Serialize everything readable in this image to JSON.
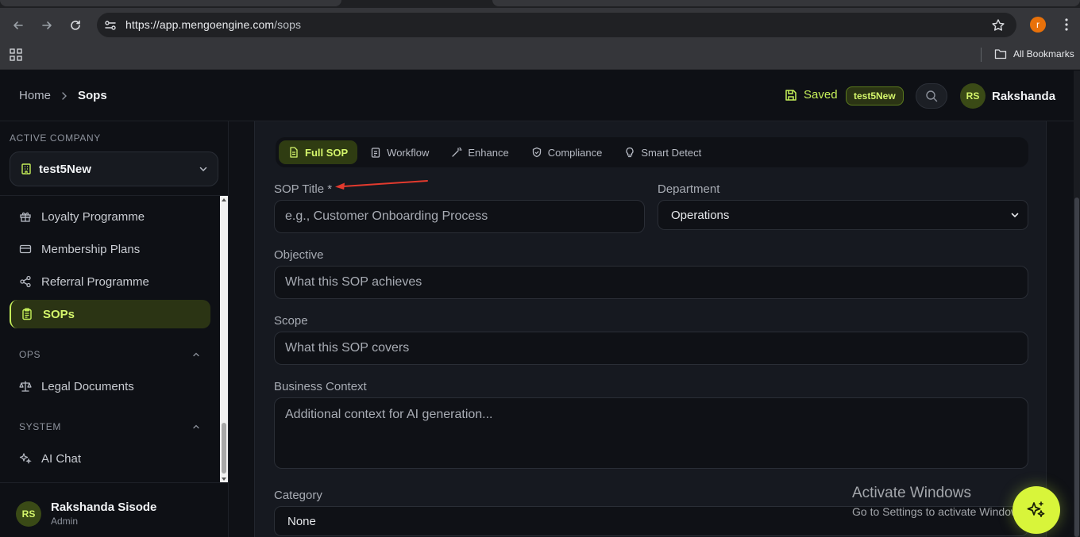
{
  "browser": {
    "url_host": "https://app.mengoengine.com",
    "url_path": "/sops",
    "profile_initial": "r",
    "bookmarks_label": "All Bookmarks"
  },
  "header": {
    "breadcrumb_home": "Home",
    "breadcrumb_current": "Sops",
    "saved_label": "Saved",
    "company_badge": "test5New",
    "user_initials": "RS",
    "user_name": "Rakshanda"
  },
  "sidebar": {
    "active_company_label": "ACTIVE COMPANY",
    "company_name": "test5New",
    "items": [
      {
        "label": "Loyalty Programme",
        "icon": "gift-icon"
      },
      {
        "label": "Membership Plans",
        "icon": "card-icon"
      },
      {
        "label": "Referral Programme",
        "icon": "share-icon"
      },
      {
        "label": "SOPs",
        "icon": "clipboard-icon",
        "active": true
      }
    ],
    "sections": [
      {
        "label": "OPS",
        "items": [
          {
            "label": "Legal Documents",
            "icon": "scale-icon"
          }
        ]
      },
      {
        "label": "SYSTEM",
        "items": [
          {
            "label": "AI Chat",
            "icon": "sparkles-icon"
          }
        ]
      }
    ],
    "user": {
      "initials": "RS",
      "name": "Rakshanda Sisode",
      "role": "Admin"
    }
  },
  "tabs": [
    {
      "label": "Full SOP",
      "active": true
    },
    {
      "label": "Workflow"
    },
    {
      "label": "Enhance"
    },
    {
      "label": "Compliance"
    },
    {
      "label": "Smart Detect"
    }
  ],
  "form": {
    "title_label": "SOP Title *",
    "title_placeholder": "e.g., Customer Onboarding Process",
    "department_label": "Department",
    "department_value": "Operations",
    "objective_label": "Objective",
    "objective_placeholder": "What this SOP achieves",
    "scope_label": "Scope",
    "scope_placeholder": "What this SOP covers",
    "context_label": "Business Context",
    "context_placeholder": "Additional context for AI generation...",
    "category_label": "Category",
    "category_value": "None"
  },
  "watermark": {
    "line1": "Activate Windows",
    "line2": "Go to Settings to activate Windows."
  },
  "colors": {
    "accent": "#c6f05a",
    "accent_bg": "#2b3414",
    "background": "#0f1116",
    "arrow": "#e23a2e"
  }
}
